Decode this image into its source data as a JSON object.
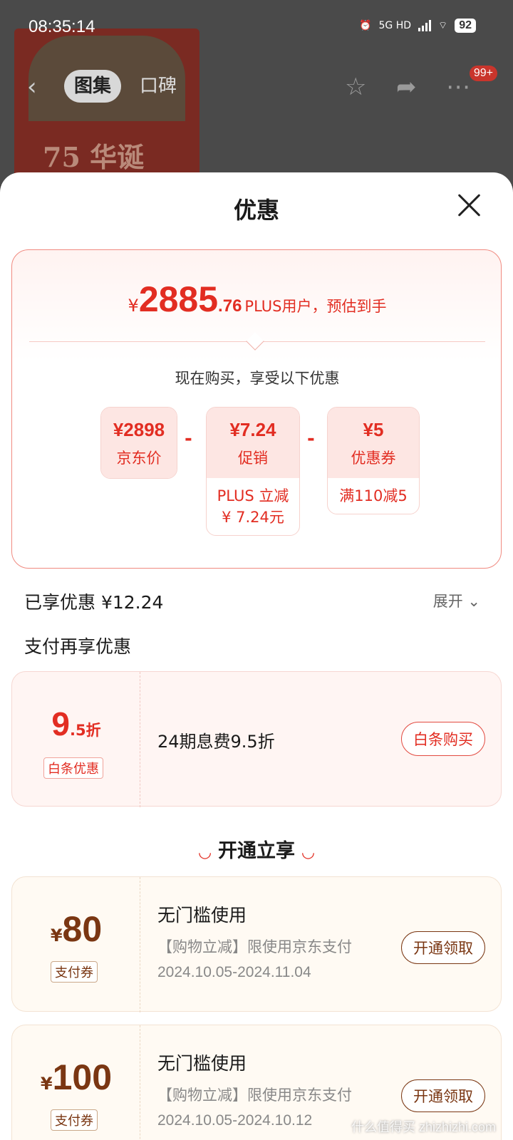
{
  "status": {
    "time": "08:35:14",
    "network": "5G HD",
    "battery": "92"
  },
  "nav": {
    "tabs": [
      "图集",
      "口碑"
    ],
    "badge": "99+"
  },
  "background": {
    "art_text": "75 华诞"
  },
  "sheet": {
    "title": "优惠",
    "summary": {
      "currency": "¥",
      "price_int": "2885",
      "price_dec": ".76",
      "note": "PLUS用户，预估到手",
      "buy_note": "现在购买，享受以下优惠"
    },
    "breakdown": [
      {
        "amount": "¥2898",
        "label": "京东价"
      },
      {
        "amount": "¥7.24",
        "label": "促销",
        "detail_line1": "PLUS 立减",
        "detail_line2": "¥ 7.24元"
      },
      {
        "amount": "¥5",
        "label": "优惠券",
        "detail_line1": "满110减5"
      }
    ],
    "minus_sign": "-",
    "enjoyed": "已享优惠 ¥12.24",
    "expand": "展开",
    "pay_title": "支付再享优惠",
    "baitiao": {
      "rate_big": "9",
      "rate_small": ".5折",
      "tag": "白条优惠",
      "desc": "24期息费9.5折",
      "button": "白条购买"
    },
    "open_header": "开通立享",
    "coupons": [
      {
        "currency": "¥",
        "amount": "80",
        "tag": "支付券",
        "title": "无门槛使用",
        "desc": "【购物立减】限使用京东支付",
        "date": "2024.10.05-2024.11.04",
        "button": "开通领取"
      },
      {
        "currency": "¥",
        "amount": "100",
        "tag": "支付券",
        "title": "无门槛使用",
        "desc": "【购物立减】限使用京东支付",
        "date": "2024.10.05-2024.10.12",
        "button": "开通领取"
      }
    ]
  },
  "watermark": "什么值得买 zhizhizhi.com",
  "colors": {
    "accent": "#e22d22",
    "coupon_brown": "#7a3612"
  }
}
